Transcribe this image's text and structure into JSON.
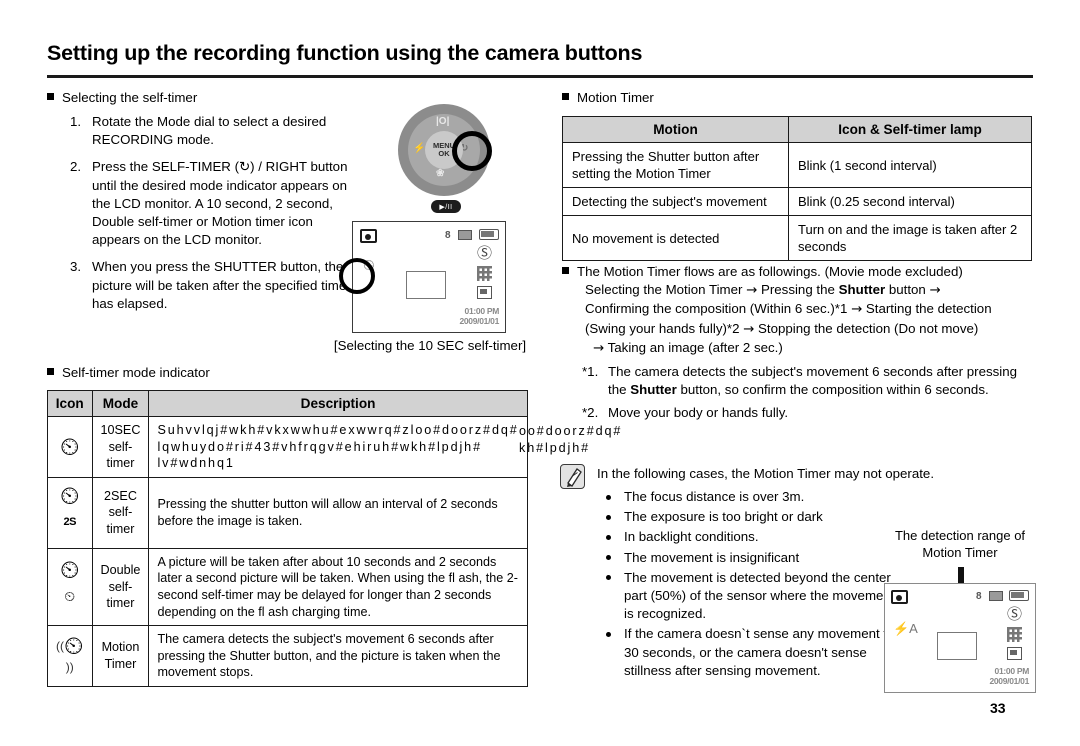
{
  "header": {
    "title": "Setting up the recording function using the camera buttons"
  },
  "left": {
    "section_heading": "Selecting the self-timer",
    "steps": [
      {
        "num": "1.",
        "text": "Rotate the Mode dial to select a desired RECORDING mode."
      },
      {
        "num": "2.",
        "text": "Press the SELF-TIMER (↻) / RIGHT button until the desired mode indicator appears on the LCD monitor. A 10 second, 2 second, Double self-timer or Motion timer icon appears on the LCD monitor."
      },
      {
        "num": "3.",
        "text": "When you press the SHUTTER button, the picture will be taken after the specified time has elapsed."
      }
    ],
    "dial": {
      "center_line1": "MENU",
      "center_line2": "OK",
      "up_label": "|O|",
      "left_label": "⚡",
      "down_label": "❀",
      "right_label": "↻",
      "play_label": "▶/II"
    },
    "lcd_caption": "[Selecting the 10 SEC self-timer]",
    "lcd_time": "01:00 PM",
    "lcd_date": "2009/01/01",
    "lcd_res": "8",
    "indicator_heading": "Self-timer mode indicator",
    "table": {
      "headers": [
        "Icon",
        "Mode",
        "Description"
      ],
      "rows": [
        {
          "icon": "selftimer-10sec-icon",
          "mode": "10SEC self-timer",
          "desc_garbled": true,
          "desc_lines": [
            "Suhvvlqj#wkh#vkxwwhu#exwwrq#zloo#doorz#dq#",
            "lqwhuydo#ri#43#vhfrqgv#ehiruh#wkh#lpdjh#",
            "lv#wdnhq1"
          ]
        },
        {
          "icon": "selftimer-2sec-icon",
          "mode": "2SEC self-timer",
          "desc_garbled": false,
          "desc": "Pressing the shutter button will allow an interval of 2 seconds before the image is taken."
        },
        {
          "icon": "selftimer-double-icon",
          "mode": "Double self-timer",
          "desc_garbled": false,
          "desc": "A picture will be taken after about 10 seconds and 2 seconds later a second picture will be taken. When using the fl ash, the 2-second self-timer may be delayed for longer than 2 seconds depending on the fl ash charging time."
        },
        {
          "icon": "motion-timer-icon",
          "mode": "Motion Timer",
          "desc_garbled": false,
          "desc": "The camera detects the subject's movement 6 seconds after pressing the Shutter button, and the picture is taken when the movement stops."
        }
      ]
    }
  },
  "right": {
    "section_heading": "Motion Timer",
    "table": {
      "headers": [
        "Motion",
        "Icon & Self-timer lamp"
      ],
      "rows": [
        {
          "motion": "Pressing the Shutter button after setting the Motion Timer",
          "lamp": "Blink (1 second interval)"
        },
        {
          "motion": "Detecting the subject's movement",
          "lamp": "Blink (0.25 second interval)"
        },
        {
          "motion": "No movement is detected",
          "lamp": "Turn on and the image is taken after 2 seconds"
        }
      ]
    },
    "flow": {
      "intro": "The Motion Timer flows are as followings. (Movie mode excluded)",
      "line2_a": "Selecting the Motion Timer",
      "line2_b": "Pressing the",
      "line2_bold": "Shutter",
      "line2_c": "button",
      "line3_a": "Confirming the composition (Within 6 sec.)*1",
      "line3_b": "Starting the detection",
      "line4_a": "(Swing your hands fully)*2",
      "line4_b": "Stopping the detection (Do not move)",
      "line5": "Taking an image (after 2 sec.)",
      "arrow": "→"
    },
    "notes": [
      {
        "mark": "*1.",
        "text_a": "The camera detects the subject's movement 6 seconds after pressing the",
        "bold": "Shutter",
        "text_b": "button, so confirm the composition within 6 seconds."
      },
      {
        "mark": "*2.",
        "text_a": "Move your body or hands fully.",
        "bold": "",
        "text_b": ""
      }
    ],
    "tip": {
      "icon": "note-pen-icon",
      "heading": "In the following cases, the Motion Timer may not operate.",
      "items": [
        "The focus distance is over 3m.",
        "The exposure is too bright or dark",
        "In backlight conditions.",
        "The movement is insignificant",
        "The movement is detected beyond the center part (50%) of the sensor where the movement is recognized.",
        "If the camera doesn`t sense any movement for 30 seconds, or the camera doesn't sense stillness after sensing movement."
      ]
    },
    "detection": {
      "caption_line1": "The detection range of",
      "caption_line2": "Motion Timer",
      "lcd_time": "01:00 PM",
      "lcd_date": "2009/01/01",
      "lcd_res": "8"
    }
  },
  "page_number": "33",
  "colors": {
    "header_rule": "#1a1a1a",
    "table_header_bg": "#d2d2d2",
    "dial_outer": "#8c8c8c",
    "dial_inner": "#a8a8a8",
    "dial_center": "#c9c9c9",
    "tip_icon_bg": "#e3e3e3"
  }
}
